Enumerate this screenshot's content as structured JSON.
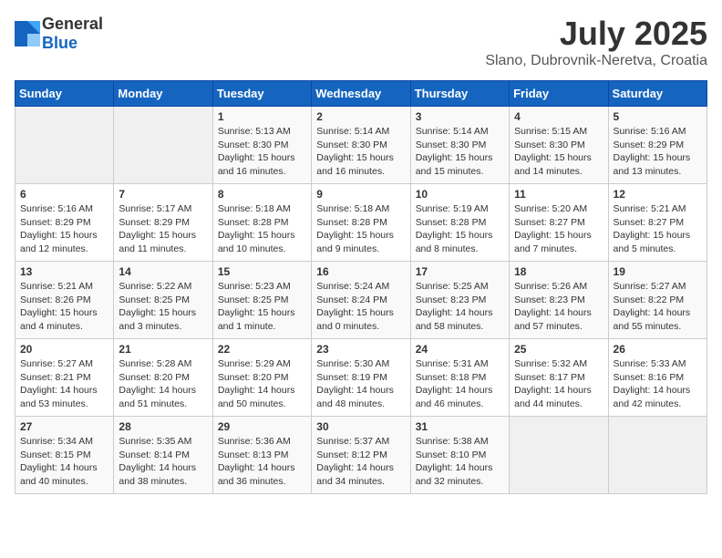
{
  "header": {
    "logo_general": "General",
    "logo_blue": "Blue",
    "title": "July 2025",
    "subtitle": "Slano, Dubrovnik-Neretva, Croatia"
  },
  "calendar": {
    "days_of_week": [
      "Sunday",
      "Monday",
      "Tuesday",
      "Wednesday",
      "Thursday",
      "Friday",
      "Saturday"
    ],
    "weeks": [
      [
        {
          "day": "",
          "sunrise": "",
          "sunset": "",
          "daylight": ""
        },
        {
          "day": "",
          "sunrise": "",
          "sunset": "",
          "daylight": ""
        },
        {
          "day": "1",
          "sunrise": "Sunrise: 5:13 AM",
          "sunset": "Sunset: 8:30 PM",
          "daylight": "Daylight: 15 hours and 16 minutes."
        },
        {
          "day": "2",
          "sunrise": "Sunrise: 5:14 AM",
          "sunset": "Sunset: 8:30 PM",
          "daylight": "Daylight: 15 hours and 16 minutes."
        },
        {
          "day": "3",
          "sunrise": "Sunrise: 5:14 AM",
          "sunset": "Sunset: 8:30 PM",
          "daylight": "Daylight: 15 hours and 15 minutes."
        },
        {
          "day": "4",
          "sunrise": "Sunrise: 5:15 AM",
          "sunset": "Sunset: 8:30 PM",
          "daylight": "Daylight: 15 hours and 14 minutes."
        },
        {
          "day": "5",
          "sunrise": "Sunrise: 5:16 AM",
          "sunset": "Sunset: 8:29 PM",
          "daylight": "Daylight: 15 hours and 13 minutes."
        }
      ],
      [
        {
          "day": "6",
          "sunrise": "Sunrise: 5:16 AM",
          "sunset": "Sunset: 8:29 PM",
          "daylight": "Daylight: 15 hours and 12 minutes."
        },
        {
          "day": "7",
          "sunrise": "Sunrise: 5:17 AM",
          "sunset": "Sunset: 8:29 PM",
          "daylight": "Daylight: 15 hours and 11 minutes."
        },
        {
          "day": "8",
          "sunrise": "Sunrise: 5:18 AM",
          "sunset": "Sunset: 8:28 PM",
          "daylight": "Daylight: 15 hours and 10 minutes."
        },
        {
          "day": "9",
          "sunrise": "Sunrise: 5:18 AM",
          "sunset": "Sunset: 8:28 PM",
          "daylight": "Daylight: 15 hours and 9 minutes."
        },
        {
          "day": "10",
          "sunrise": "Sunrise: 5:19 AM",
          "sunset": "Sunset: 8:28 PM",
          "daylight": "Daylight: 15 hours and 8 minutes."
        },
        {
          "day": "11",
          "sunrise": "Sunrise: 5:20 AM",
          "sunset": "Sunset: 8:27 PM",
          "daylight": "Daylight: 15 hours and 7 minutes."
        },
        {
          "day": "12",
          "sunrise": "Sunrise: 5:21 AM",
          "sunset": "Sunset: 8:27 PM",
          "daylight": "Daylight: 15 hours and 5 minutes."
        }
      ],
      [
        {
          "day": "13",
          "sunrise": "Sunrise: 5:21 AM",
          "sunset": "Sunset: 8:26 PM",
          "daylight": "Daylight: 15 hours and 4 minutes."
        },
        {
          "day": "14",
          "sunrise": "Sunrise: 5:22 AM",
          "sunset": "Sunset: 8:25 PM",
          "daylight": "Daylight: 15 hours and 3 minutes."
        },
        {
          "day": "15",
          "sunrise": "Sunrise: 5:23 AM",
          "sunset": "Sunset: 8:25 PM",
          "daylight": "Daylight: 15 hours and 1 minute."
        },
        {
          "day": "16",
          "sunrise": "Sunrise: 5:24 AM",
          "sunset": "Sunset: 8:24 PM",
          "daylight": "Daylight: 15 hours and 0 minutes."
        },
        {
          "day": "17",
          "sunrise": "Sunrise: 5:25 AM",
          "sunset": "Sunset: 8:23 PM",
          "daylight": "Daylight: 14 hours and 58 minutes."
        },
        {
          "day": "18",
          "sunrise": "Sunrise: 5:26 AM",
          "sunset": "Sunset: 8:23 PM",
          "daylight": "Daylight: 14 hours and 57 minutes."
        },
        {
          "day": "19",
          "sunrise": "Sunrise: 5:27 AM",
          "sunset": "Sunset: 8:22 PM",
          "daylight": "Daylight: 14 hours and 55 minutes."
        }
      ],
      [
        {
          "day": "20",
          "sunrise": "Sunrise: 5:27 AM",
          "sunset": "Sunset: 8:21 PM",
          "daylight": "Daylight: 14 hours and 53 minutes."
        },
        {
          "day": "21",
          "sunrise": "Sunrise: 5:28 AM",
          "sunset": "Sunset: 8:20 PM",
          "daylight": "Daylight: 14 hours and 51 minutes."
        },
        {
          "day": "22",
          "sunrise": "Sunrise: 5:29 AM",
          "sunset": "Sunset: 8:20 PM",
          "daylight": "Daylight: 14 hours and 50 minutes."
        },
        {
          "day": "23",
          "sunrise": "Sunrise: 5:30 AM",
          "sunset": "Sunset: 8:19 PM",
          "daylight": "Daylight: 14 hours and 48 minutes."
        },
        {
          "day": "24",
          "sunrise": "Sunrise: 5:31 AM",
          "sunset": "Sunset: 8:18 PM",
          "daylight": "Daylight: 14 hours and 46 minutes."
        },
        {
          "day": "25",
          "sunrise": "Sunrise: 5:32 AM",
          "sunset": "Sunset: 8:17 PM",
          "daylight": "Daylight: 14 hours and 44 minutes."
        },
        {
          "day": "26",
          "sunrise": "Sunrise: 5:33 AM",
          "sunset": "Sunset: 8:16 PM",
          "daylight": "Daylight: 14 hours and 42 minutes."
        }
      ],
      [
        {
          "day": "27",
          "sunrise": "Sunrise: 5:34 AM",
          "sunset": "Sunset: 8:15 PM",
          "daylight": "Daylight: 14 hours and 40 minutes."
        },
        {
          "day": "28",
          "sunrise": "Sunrise: 5:35 AM",
          "sunset": "Sunset: 8:14 PM",
          "daylight": "Daylight: 14 hours and 38 minutes."
        },
        {
          "day": "29",
          "sunrise": "Sunrise: 5:36 AM",
          "sunset": "Sunset: 8:13 PM",
          "daylight": "Daylight: 14 hours and 36 minutes."
        },
        {
          "day": "30",
          "sunrise": "Sunrise: 5:37 AM",
          "sunset": "Sunset: 8:12 PM",
          "daylight": "Daylight: 14 hours and 34 minutes."
        },
        {
          "day": "31",
          "sunrise": "Sunrise: 5:38 AM",
          "sunset": "Sunset: 8:10 PM",
          "daylight": "Daylight: 14 hours and 32 minutes."
        },
        {
          "day": "",
          "sunrise": "",
          "sunset": "",
          "daylight": ""
        },
        {
          "day": "",
          "sunrise": "",
          "sunset": "",
          "daylight": ""
        }
      ]
    ]
  }
}
